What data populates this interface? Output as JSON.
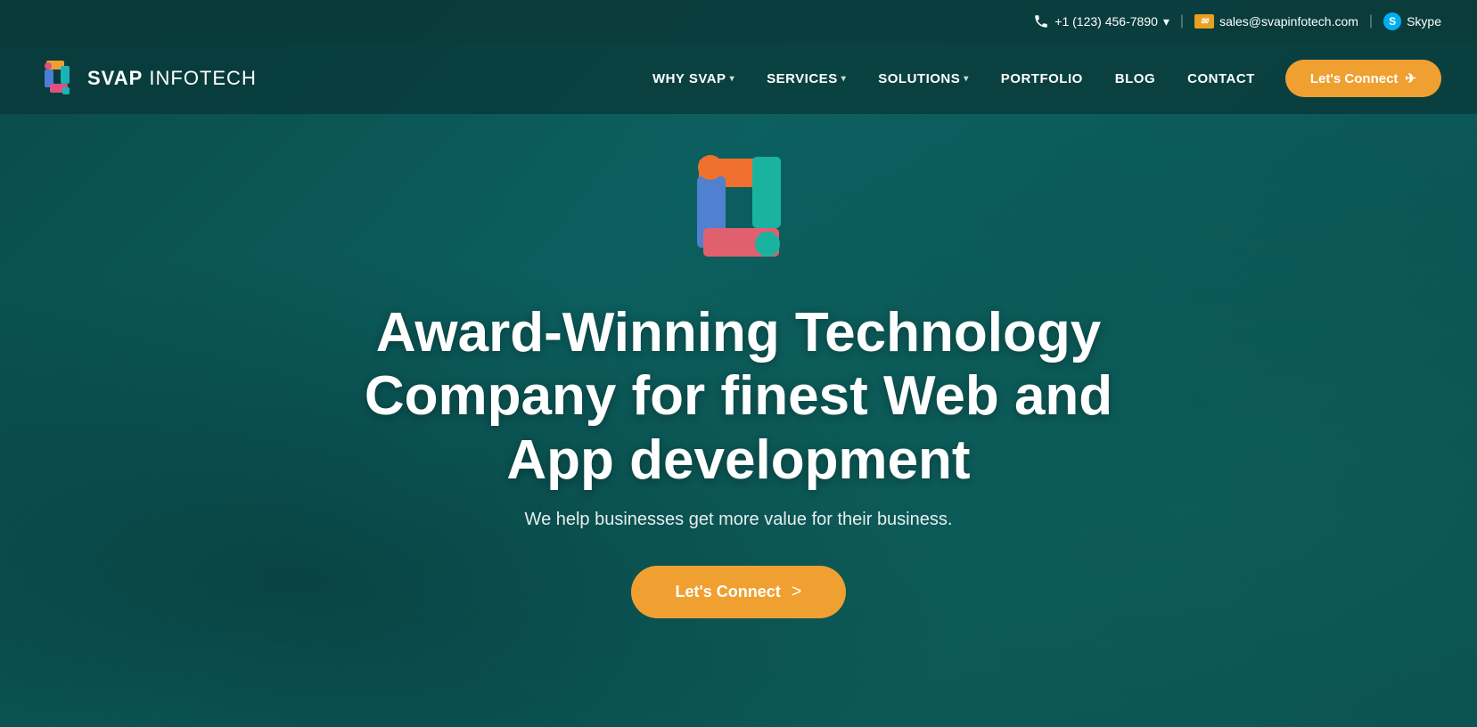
{
  "topbar": {
    "phone_label": "+1 (123) 456-7890",
    "phone_dropdown": "▾",
    "separator1": "|",
    "email_icon_text": "✉",
    "email": "sales@svapinfotech.com",
    "separator2": "|",
    "skype_icon_text": "S",
    "skype_label": "Skype"
  },
  "navbar": {
    "logo_name_bold": "SVAP",
    "logo_name_light": " INFOTECH",
    "nav_items": [
      {
        "label": "WHY SVAP",
        "has_dropdown": true
      },
      {
        "label": "SERVICES",
        "has_dropdown": true
      },
      {
        "label": "SOLUTIONS",
        "has_dropdown": true
      },
      {
        "label": "PORTFOLIO",
        "has_dropdown": false
      },
      {
        "label": "BLOG",
        "has_dropdown": false
      },
      {
        "label": "CONTACT",
        "has_dropdown": false
      }
    ],
    "cta_button": "Let's Connect",
    "cta_icon": "✈"
  },
  "hero": {
    "title": "Award-Winning Technology Company for finest Web and App development",
    "subtitle": "We help businesses get more value for their business.",
    "cta_button": "Let's Connect",
    "cta_arrow": ">"
  },
  "colors": {
    "teal_dark": "#0a4a4a",
    "teal_mid": "#0d6060",
    "orange": "#f0a030",
    "white": "#ffffff"
  }
}
